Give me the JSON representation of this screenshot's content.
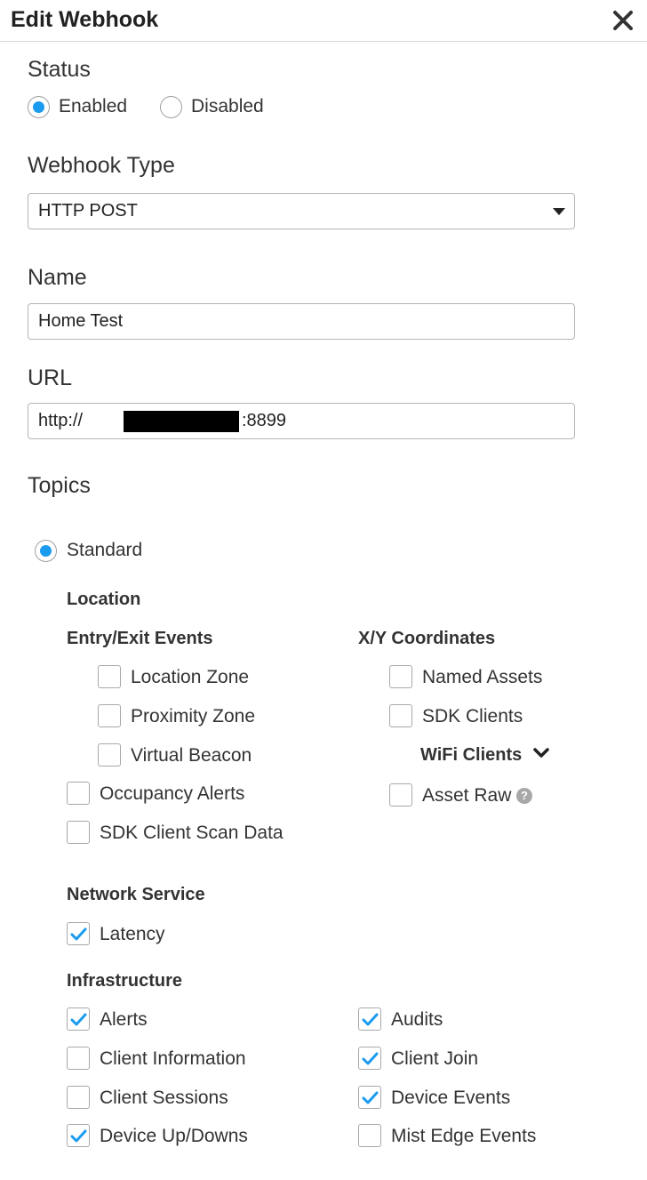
{
  "header": {
    "title": "Edit Webhook"
  },
  "status": {
    "label": "Status",
    "options": [
      {
        "label": "Enabled",
        "selected": true
      },
      {
        "label": "Disabled",
        "selected": false
      }
    ]
  },
  "webhook_type": {
    "label": "Webhook Type",
    "value": "HTTP POST"
  },
  "name": {
    "label": "Name",
    "value": "Home Test"
  },
  "url": {
    "label": "URL",
    "value_prefix": "http://",
    "value_suffix": ":8899"
  },
  "topics": {
    "label": "Topics",
    "mode": {
      "label": "Standard",
      "selected": true
    },
    "location": {
      "label": "Location",
      "entry_exit": {
        "label": "Entry/Exit Events",
        "items": [
          {
            "label": "Location Zone",
            "checked": false
          },
          {
            "label": "Proximity Zone",
            "checked": false
          },
          {
            "label": "Virtual Beacon",
            "checked": false
          }
        ]
      },
      "extra": [
        {
          "label": "Occupancy Alerts",
          "checked": false
        },
        {
          "label": "SDK Client Scan Data",
          "checked": false
        }
      ],
      "xy": {
        "label": "X/Y Coordinates",
        "items": [
          {
            "label": "Named Assets",
            "checked": false
          },
          {
            "label": "SDK Clients",
            "checked": false
          }
        ],
        "wifi_clients": "WiFi Clients",
        "asset_raw": {
          "label": "Asset Raw",
          "checked": false,
          "help_icon": "?"
        }
      }
    },
    "network_service": {
      "label": "Network Service",
      "items": [
        {
          "label": "Latency",
          "checked": true
        }
      ]
    },
    "infrastructure": {
      "label": "Infrastructure",
      "left": [
        {
          "label": "Alerts",
          "checked": true
        },
        {
          "label": "Client Information",
          "checked": false
        },
        {
          "label": "Client Sessions",
          "checked": false
        },
        {
          "label": "Device Up/Downs",
          "checked": true
        }
      ],
      "right": [
        {
          "label": "Audits",
          "checked": true
        },
        {
          "label": "Client Join",
          "checked": true
        },
        {
          "label": "Device Events",
          "checked": true
        },
        {
          "label": "Mist Edge Events",
          "checked": false
        }
      ]
    }
  },
  "colors": {
    "accent": "#1a9bef",
    "border": "#a8a8a8",
    "text": "#333333"
  }
}
